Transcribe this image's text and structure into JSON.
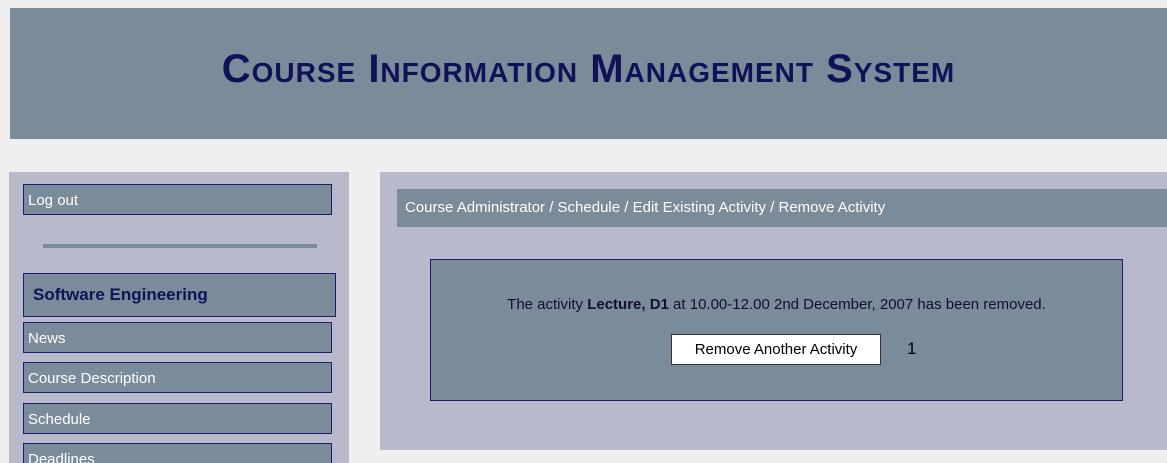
{
  "header": {
    "title": "Course Information Management System"
  },
  "sidebar": {
    "logout_label": "Log out",
    "course_heading": "Software Engineering",
    "items": [
      {
        "label": "News"
      },
      {
        "label": "Course Description"
      },
      {
        "label": "Schedule"
      },
      {
        "label": "Deadlines"
      }
    ]
  },
  "main": {
    "breadcrumb": "Course Administrator / Schedule / Edit Existing Activity / Remove Activity",
    "notice": {
      "prefix": "The activity ",
      "activity_name": "Lecture, D1",
      "suffix": " at 10.00-12.00 2nd December, 2007 has been removed."
    },
    "remove_another_label": "Remove Another Activity",
    "step_number": "1"
  },
  "colors": {
    "banner_bg": "#7a8b9a",
    "title_color": "#101258",
    "panel_bg": "#b9b9cc",
    "border": "#1a1c6e"
  }
}
